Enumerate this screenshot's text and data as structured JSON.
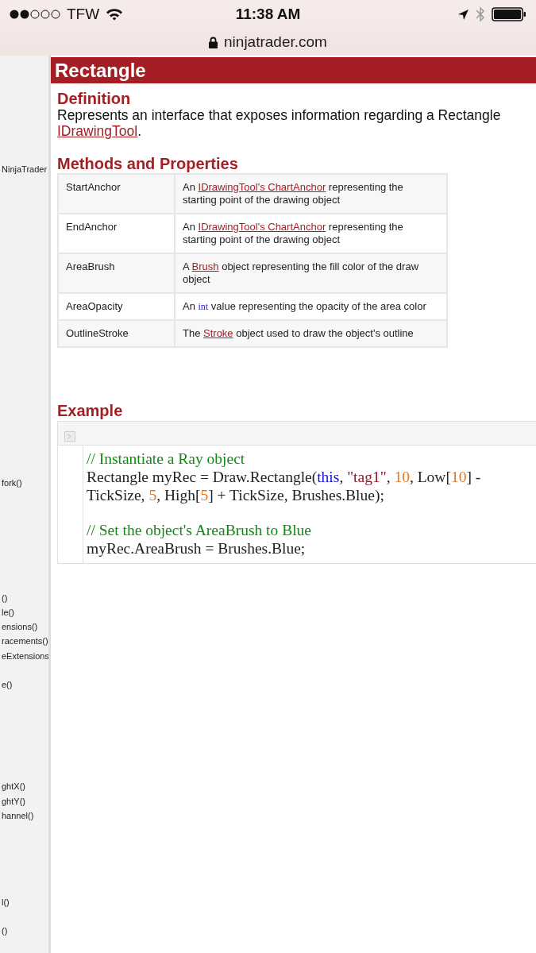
{
  "status_bar": {
    "carrier": "TFW",
    "time": "11:38 AM"
  },
  "address_bar": {
    "url": "ninjatrader.com"
  },
  "sidebar": {
    "groups": [
      [
        "NinjaTrader"
      ],
      [
        "fork()"
      ],
      [
        "()",
        "le()",
        "ensions()",
        "racements()",
        "eExtensions"
      ],
      [
        "e()"
      ],
      [
        "ghtX()",
        "ghtY()",
        "hannel()"
      ],
      [
        "l()"
      ],
      [
        "()"
      ]
    ]
  },
  "page": {
    "title": "Rectangle",
    "definition": {
      "heading": "Definition",
      "text": [
        {
          "text": "Represents an interface that exposes information regarding a Rectangle "
        },
        {
          "text": "IDrawingTool",
          "kind": "link"
        },
        {
          "text": "."
        }
      ]
    },
    "methods": {
      "heading": "Methods and Properties",
      "rows": [
        {
          "name": "StartAnchor",
          "description": [
            {
              "text": "An "
            },
            {
              "text": "IDrawingTool's ChartAnchor",
              "kind": "link"
            },
            {
              "text": " representing the starting point of the drawing object"
            }
          ]
        },
        {
          "name": "EndAnchor",
          "description": [
            {
              "text": "An "
            },
            {
              "text": "IDrawingTool's ChartAnchor",
              "kind": "link"
            },
            {
              "text": " representing the starting point of the drawing object"
            }
          ]
        },
        {
          "name": "AreaBrush",
          "description": [
            {
              "text": "A "
            },
            {
              "text": "Brush",
              "kind": "link"
            },
            {
              "text": " object representing the fill color of the draw object"
            }
          ]
        },
        {
          "name": "AreaOpacity",
          "description": [
            {
              "text": "An "
            },
            {
              "text": "int",
              "kind": "code"
            },
            {
              "text": " value representing the opacity of the area color"
            }
          ]
        },
        {
          "name": "OutlineStroke",
          "description": [
            {
              "text": "The "
            },
            {
              "text": "Stroke",
              "kind": "link"
            },
            {
              "text": " object used to draw the object's outline"
            }
          ]
        }
      ]
    },
    "example": {
      "heading": "Example",
      "code_blocks": [
        [
          [
            {
              "text": "// Instantiate a Ray object",
              "kind": "comment"
            }
          ],
          [
            {
              "text": "Rectangle myRec = Draw.Rectangle("
            },
            {
              "text": "this",
              "kind": "keyword"
            },
            {
              "text": ", "
            },
            {
              "text": "\"tag1\"",
              "kind": "string"
            },
            {
              "text": ", "
            },
            {
              "text": "10",
              "kind": "number"
            },
            {
              "text": ", Low["
            },
            {
              "text": "10",
              "kind": "number"
            },
            {
              "text": "] -"
            }
          ],
          [
            {
              "text": "TickSize, "
            },
            {
              "text": "5",
              "kind": "number"
            },
            {
              "text": ", High["
            },
            {
              "text": "5",
              "kind": "number"
            },
            {
              "text": "] + TickSize, Brushes.Blue);"
            }
          ]
        ],
        [
          [
            {
              "text": "// Set the object's AreaBrush to Blue",
              "kind": "comment"
            }
          ],
          [
            {
              "text": "myRec.AreaBrush = Brushes.Blue;"
            }
          ]
        ]
      ]
    }
  }
}
